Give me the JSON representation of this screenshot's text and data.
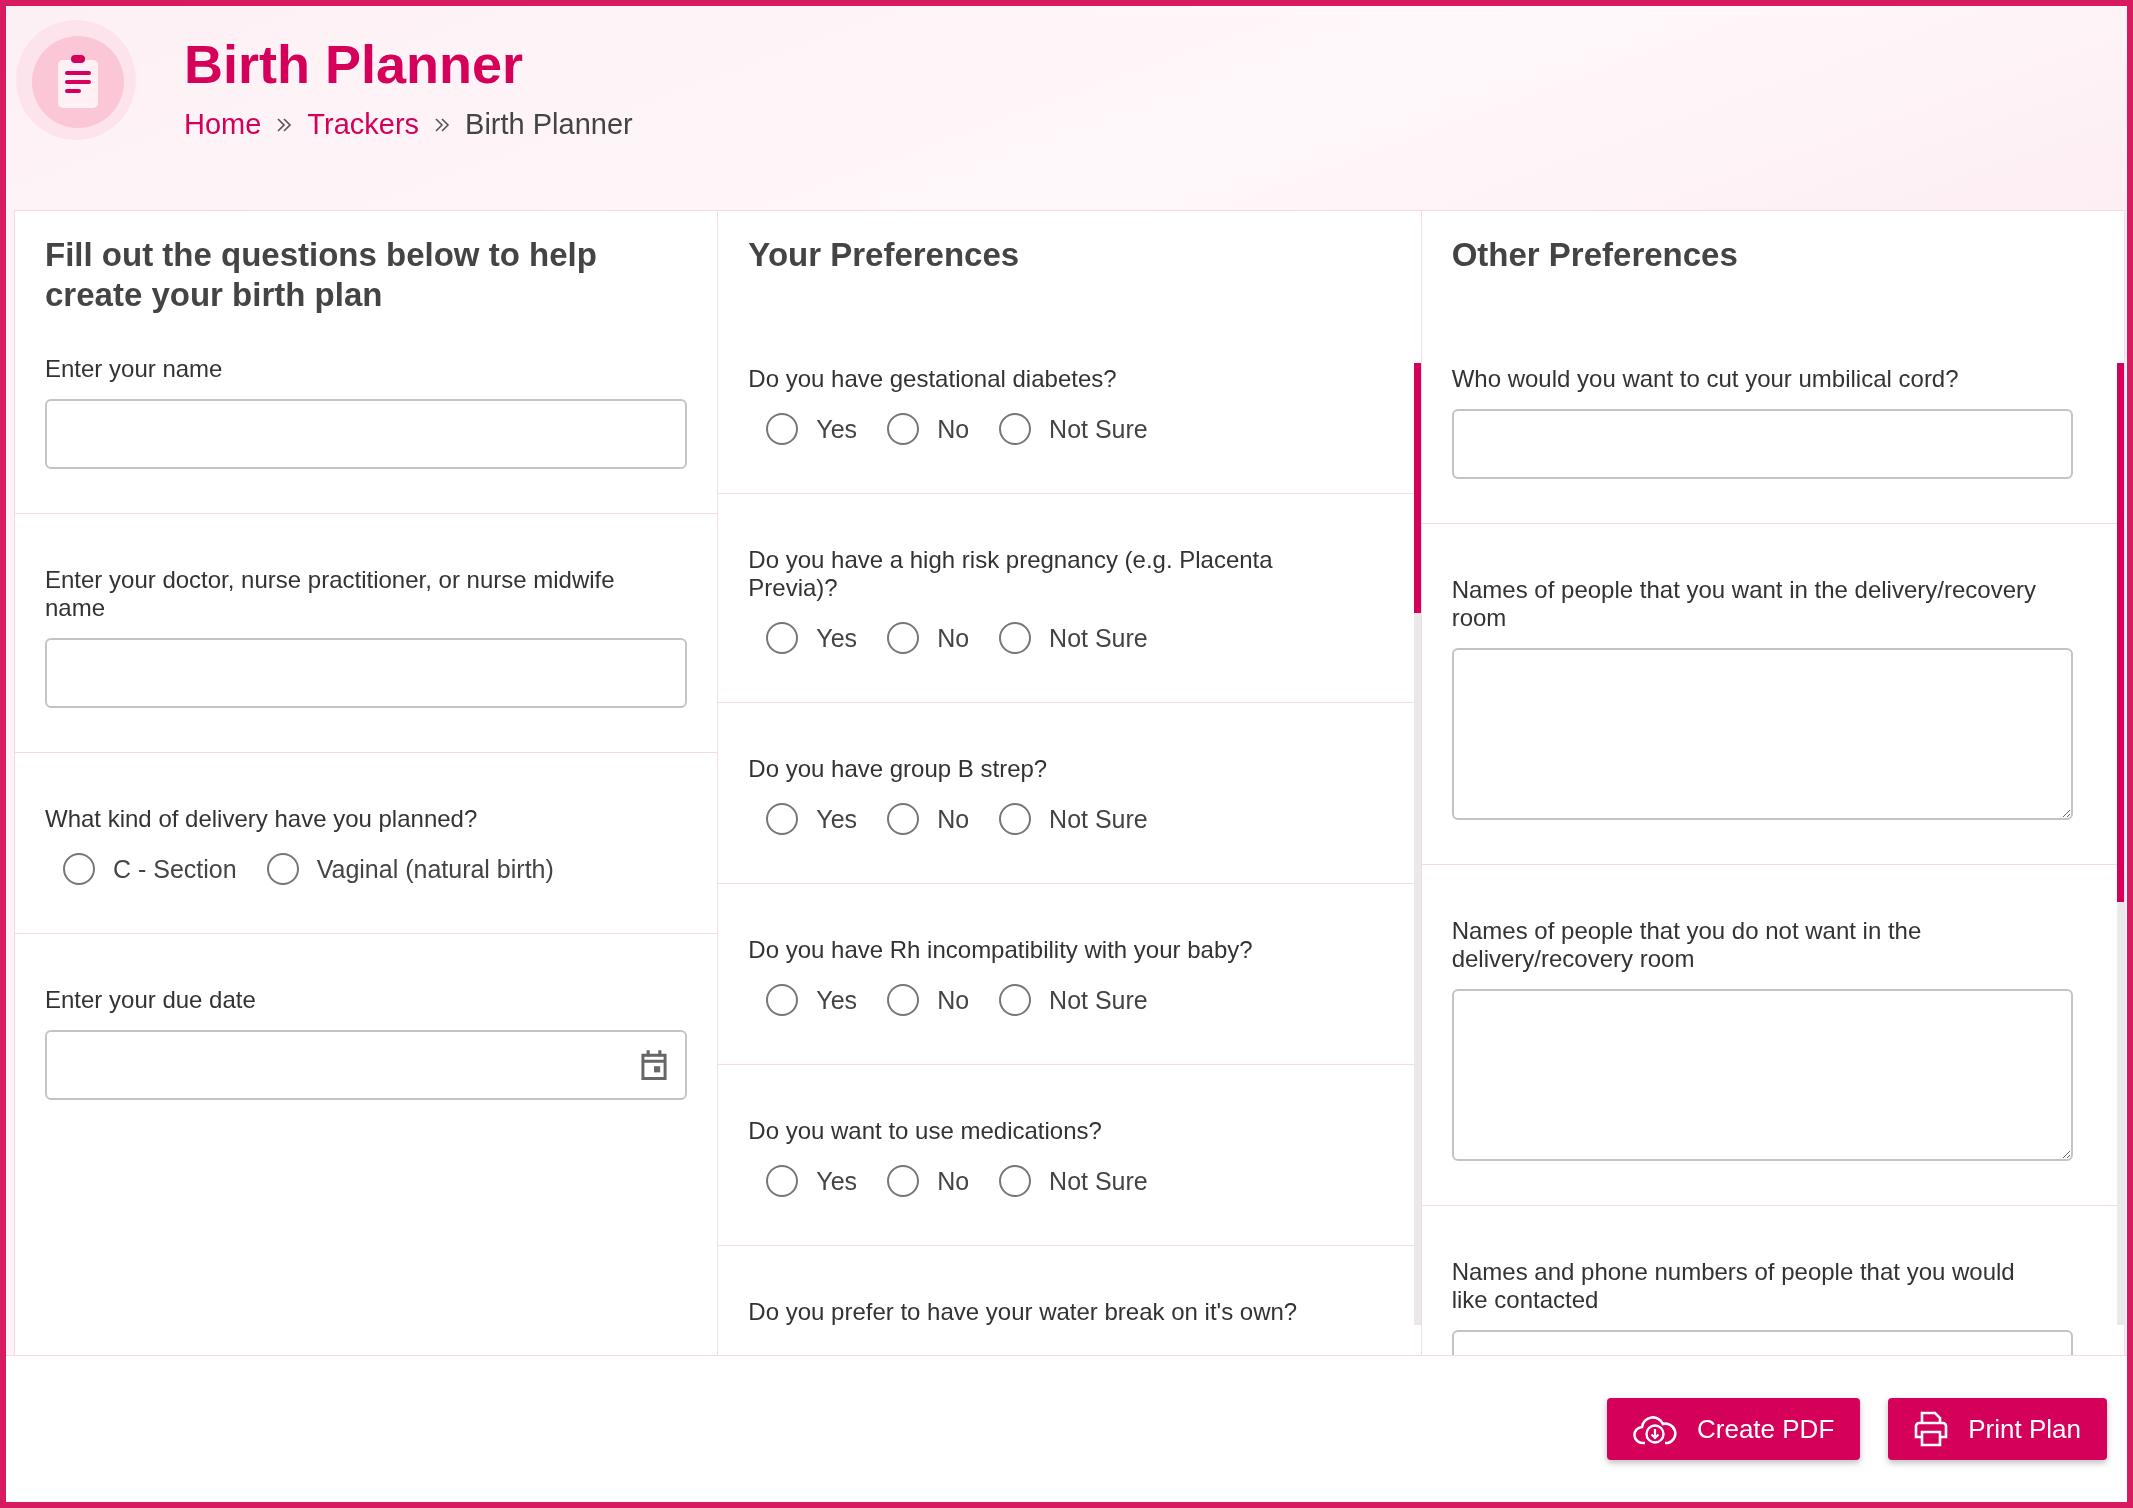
{
  "header": {
    "title": "Birth Planner",
    "breadcrumb": [
      {
        "label": "Home",
        "current": false
      },
      {
        "label": "Trackers",
        "current": false
      },
      {
        "label": "Birth Planner",
        "current": true
      }
    ]
  },
  "columns": [
    {
      "heading": "Fill out the questions below to help create your birth plan",
      "scrollable": false,
      "questions": [
        {
          "kind": "text",
          "label": "Enter your name"
        },
        {
          "kind": "text",
          "label": "Enter your doctor, nurse practitioner, or nurse midwife name"
        },
        {
          "kind": "radio",
          "label": "What kind of delivery have you planned?",
          "options": [
            {
              "label": "C - Section",
              "selected": false
            },
            {
              "label": "Vaginal (natural birth)",
              "selected": false
            }
          ]
        },
        {
          "kind": "date",
          "label": "Enter your due date"
        }
      ]
    },
    {
      "heading": "Your Preferences",
      "scrollable": true,
      "questions": [
        {
          "kind": "radio",
          "label": "Do you have gestational diabetes?",
          "options": [
            {
              "label": "Yes",
              "selected": false
            },
            {
              "label": "No",
              "selected": false
            },
            {
              "label": "Not Sure",
              "selected": false
            }
          ]
        },
        {
          "kind": "radio",
          "label": "Do you have a high risk pregnancy (e.g. Placenta Previa)?",
          "options": [
            {
              "label": "Yes",
              "selected": false
            },
            {
              "label": "No",
              "selected": false
            },
            {
              "label": "Not Sure",
              "selected": false
            }
          ]
        },
        {
          "kind": "radio",
          "label": "Do you have group B strep?",
          "options": [
            {
              "label": "Yes",
              "selected": false
            },
            {
              "label": "No",
              "selected": false
            },
            {
              "label": "Not Sure",
              "selected": false
            }
          ]
        },
        {
          "kind": "radio",
          "label": "Do you have Rh incompatibility with your baby?",
          "options": [
            {
              "label": "Yes",
              "selected": false
            },
            {
              "label": "No",
              "selected": false
            },
            {
              "label": "Not Sure",
              "selected": false
            }
          ]
        },
        {
          "kind": "radio",
          "label": "Do you want to use medications?",
          "options": [
            {
              "label": "Yes",
              "selected": false
            },
            {
              "label": "No",
              "selected": false
            },
            {
              "label": "Not Sure",
              "selected": false
            }
          ]
        },
        {
          "kind": "radio",
          "label": "Do you prefer to have your water break on it's own?"
        }
      ]
    },
    {
      "heading": "Other Preferences",
      "scrollable": true,
      "questions": [
        {
          "kind": "text",
          "label": "Who would you want to cut your umbilical cord?"
        },
        {
          "kind": "textarea",
          "label": "Names of people that you want in the delivery/recovery room"
        },
        {
          "kind": "textarea",
          "label": "Names of people that you do not want in the delivery/recovery room"
        },
        {
          "kind": "text",
          "label": "Names and phone numbers of people that you would like contacted"
        }
      ]
    }
  ],
  "buttons": [
    {
      "label": "Create PDF"
    },
    {
      "label": "Print Plan"
    }
  ]
}
